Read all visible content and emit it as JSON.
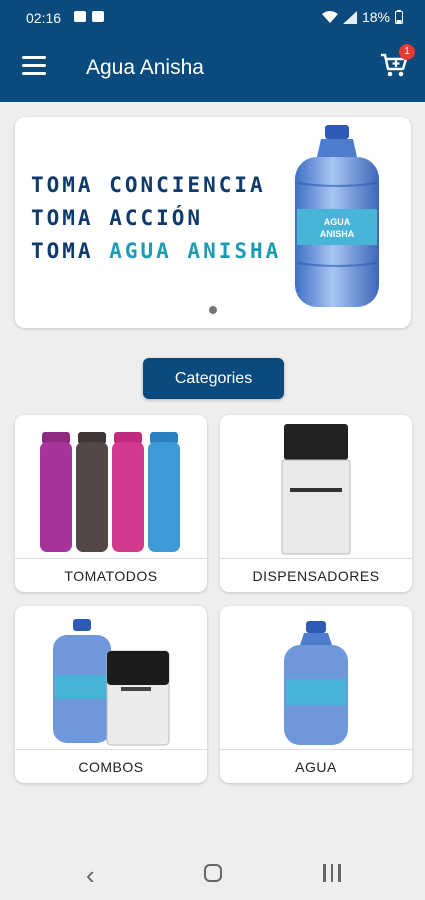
{
  "status_bar": {
    "time": "02:16",
    "battery": "18%"
  },
  "app_bar": {
    "title": "Agua Anisha",
    "cart_count": "1"
  },
  "banner": {
    "line1": "TOMA CONCIENCIA",
    "line2": "TOMA ACCIÓN",
    "line3_prefix": "TOMA ",
    "line3_accent": "AGUA ANISHA",
    "bottle_label_line1": "AGUA",
    "bottle_label_line2": "ANISHA"
  },
  "categories_button": "Categories",
  "categories": [
    {
      "label": "TOMATODOS"
    },
    {
      "label": "DISPENSADORES"
    },
    {
      "label": "COMBOS"
    },
    {
      "label": "AGUA"
    }
  ],
  "colors": {
    "primary": "#0a4a7c",
    "accent": "#1d9bb4",
    "badge": "#e53935"
  },
  "icons": [
    "menu-icon",
    "cart-icon",
    "back-icon",
    "home-icon",
    "recents-icon"
  ]
}
